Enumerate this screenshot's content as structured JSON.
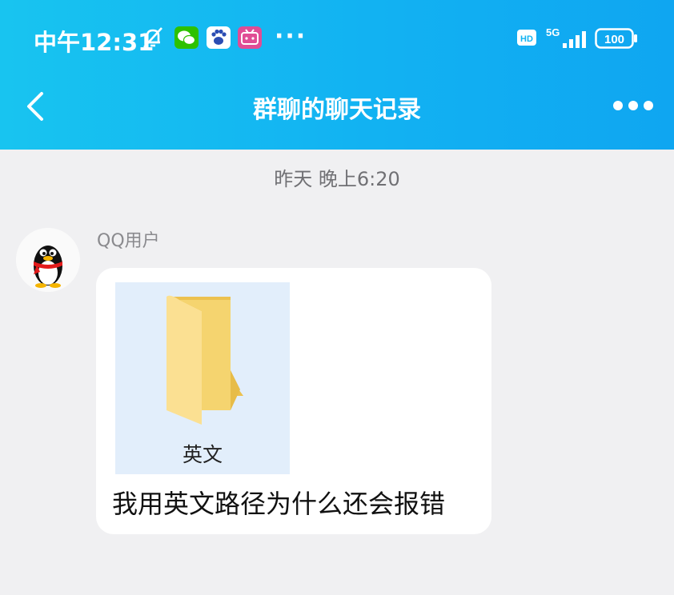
{
  "status_bar": {
    "time": "中午12:31",
    "dots": "···",
    "network": "5G",
    "hd": "HD",
    "battery": "100"
  },
  "nav": {
    "title": "群聊的聊天记录"
  },
  "chat": {
    "timestamp": "昨天 晚上6:20",
    "messages": [
      {
        "sender": "QQ用户",
        "attachment": {
          "type": "folder",
          "name": "英文"
        },
        "text": "我用英文路径为什么还会报错"
      }
    ]
  },
  "colors": {
    "header_gradient_start": "#18c4f0",
    "header_gradient_end": "#0fa6f1",
    "background": "#f0f0f2",
    "bubble": "#ffffff",
    "file_card": "#e2eefb",
    "folder": "#f5d46f"
  }
}
